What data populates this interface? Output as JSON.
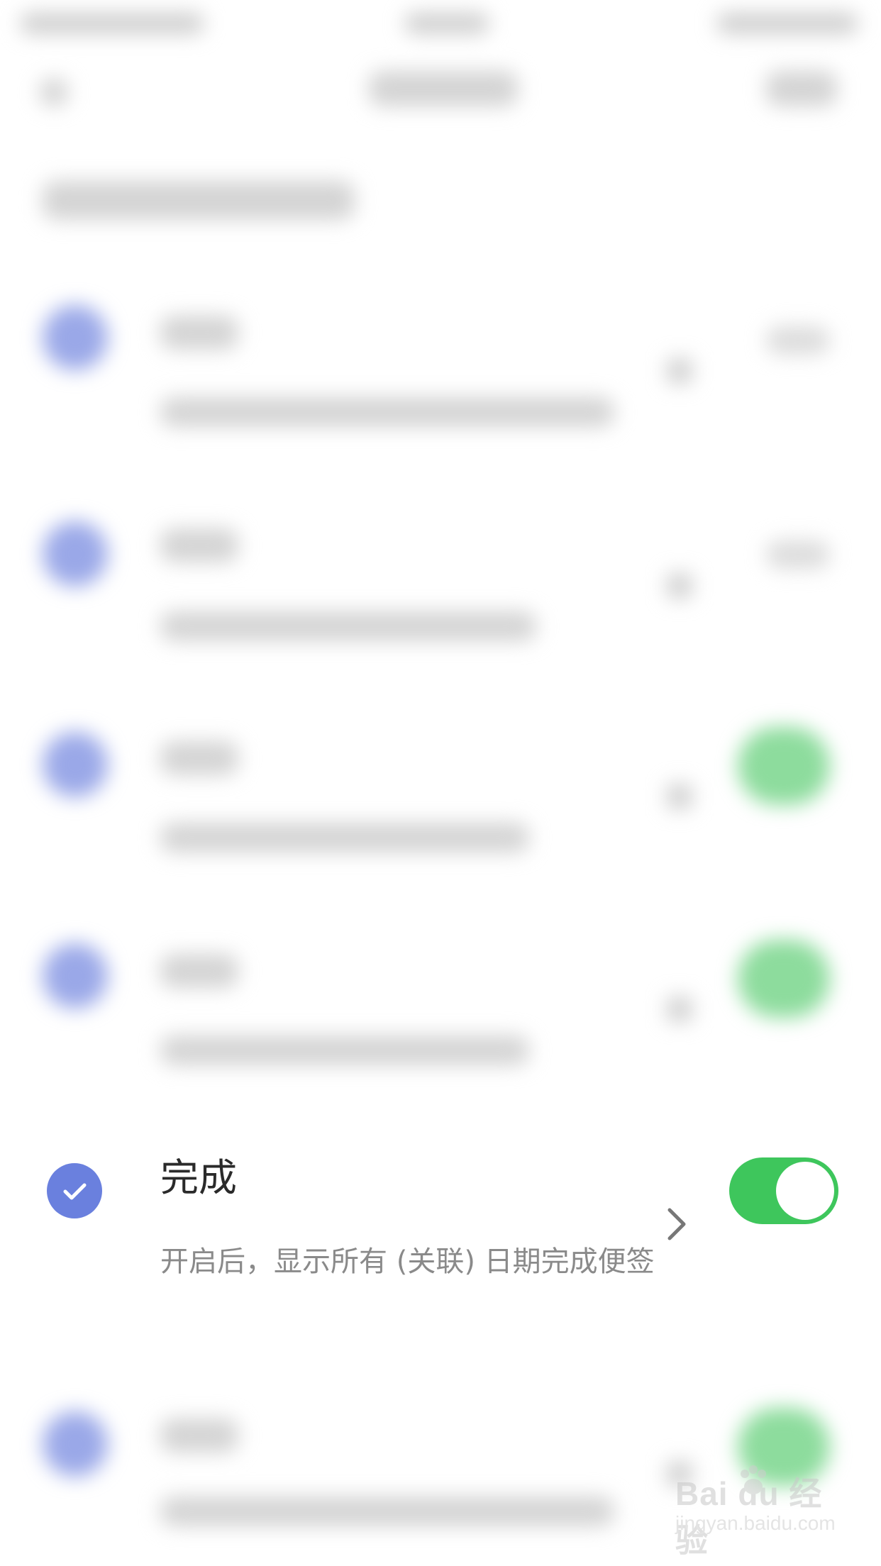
{
  "focused_item": {
    "title": "完成",
    "description": "开启后，显示所有 (关联) 日期完成便签",
    "checked": true,
    "toggle_on": true
  },
  "colors": {
    "check_accent": "#6a80de",
    "toggle_on": "#3ec65c",
    "title_text": "#2a2a2a",
    "desc_text": "#8a8a8a"
  },
  "icons": {
    "check": "checkmark-icon",
    "chevron": "chevron-right-icon"
  },
  "watermark": {
    "logo": "Bai du 经验",
    "url": "jingyan.baidu.com"
  }
}
